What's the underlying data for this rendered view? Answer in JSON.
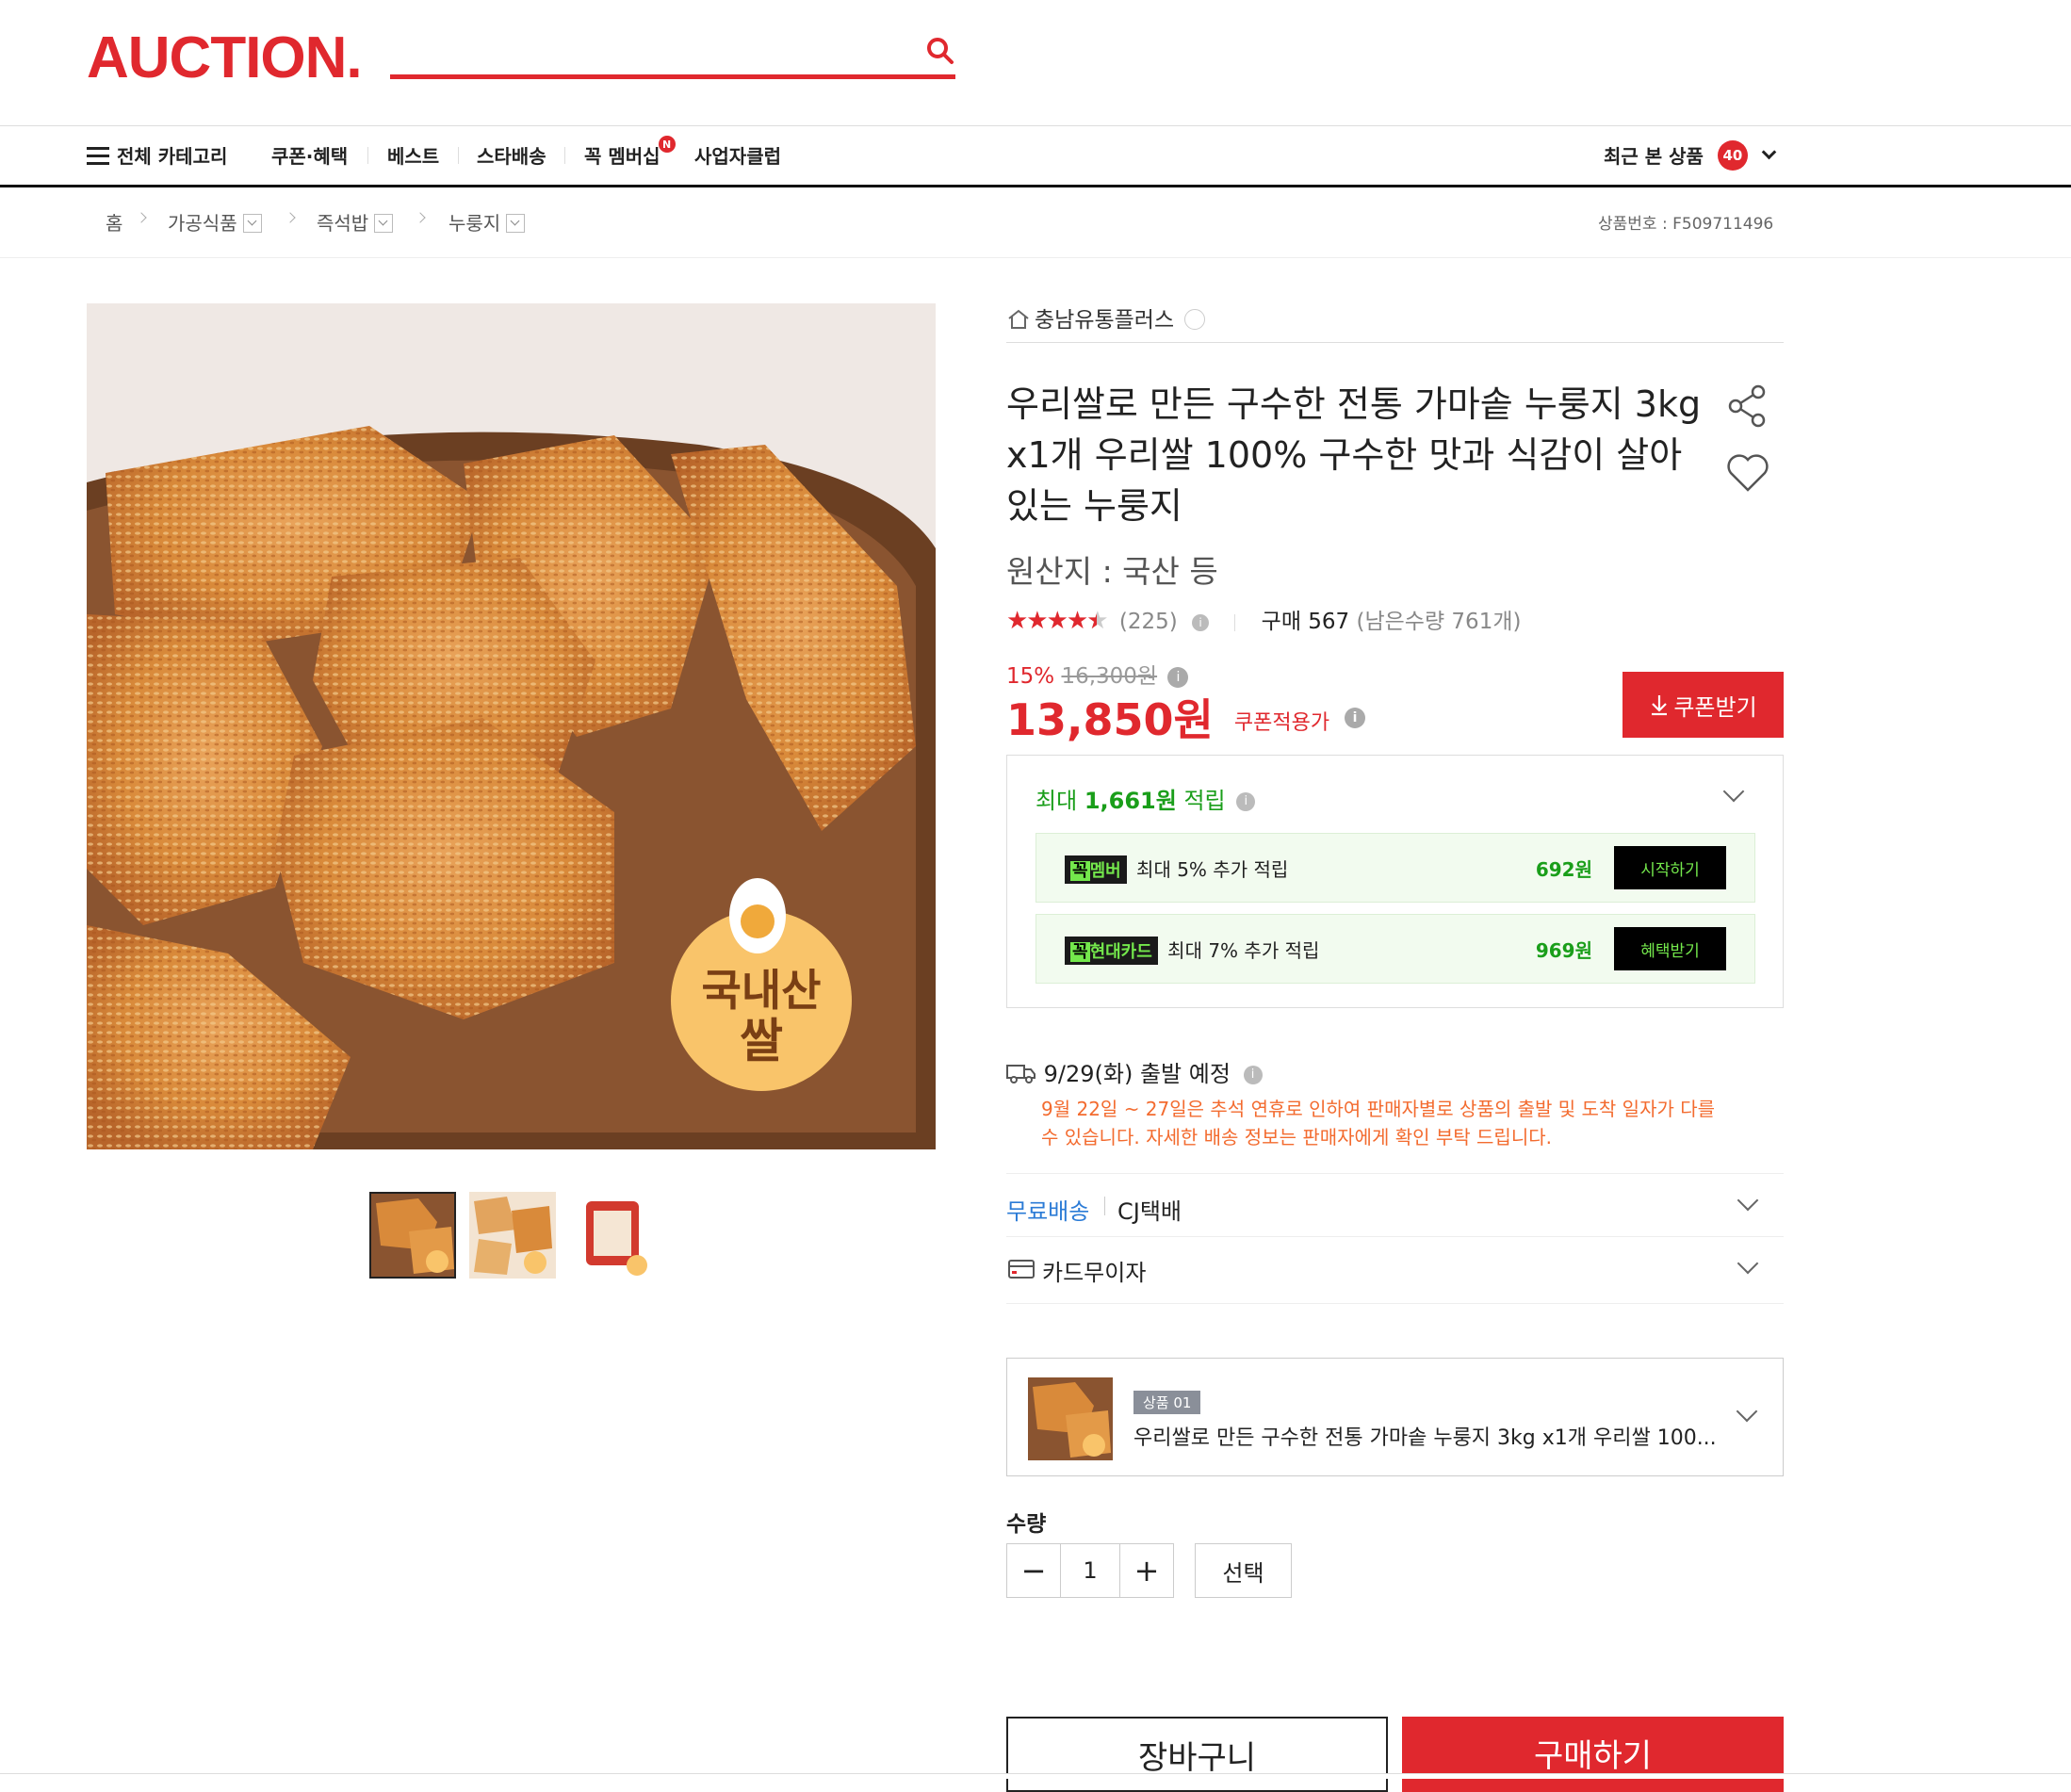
{
  "header": {
    "logo": "AUCTION.",
    "search_placeholder": ""
  },
  "gnb": {
    "all_category": "전체 카테고리",
    "items": [
      "쿠폰·혜택",
      "베스트",
      "스타배송",
      "꼭 멤버십",
      "사업자클럽"
    ],
    "new_badge": "N",
    "recent_label": "최근 본 상품",
    "recent_count": "40"
  },
  "breadcrumb": {
    "home": "홈",
    "items": [
      "가공식품",
      "즉석밥",
      "누룽지"
    ],
    "product_no": "상품번호 : F509711496"
  },
  "product": {
    "seller": "충남유통플러스",
    "title": "우리쌀로 만든 구수한 전통 가마솥 누룽지 3kg x1개 우리쌀 100% 구수한 맛과 식감이 살아있는 누룽지",
    "origin": "원산지 : 국산 등",
    "rating": 4.5,
    "review_count": "(225)",
    "purchase": "구매 567",
    "remaining": "(남은수량 761개)",
    "discount": "15%",
    "original_price": "16,300원",
    "price": "13,850원",
    "coupon_price_label": "쿠폰적용가",
    "coupon_button": "쿠폰받기",
    "image_badge": "국내산 쌀"
  },
  "reward": {
    "max_label": "최대",
    "max_amount": "1,661원",
    "max_suffix": "적립",
    "benefits": [
      {
        "badge_a": "꼭",
        "badge_b": "멤버",
        "text": "최대 5% 추가 적립",
        "amount": "692원",
        "button": "시작하기"
      },
      {
        "badge_a": "꼭",
        "badge_b": "현대카드",
        "text": "최대 7% 추가 적립",
        "amount": "969원",
        "button": "혜택받기"
      }
    ]
  },
  "shipping": {
    "date": "9/29(화) 출발 예정",
    "notice": "9월 22일 ~ 27일은 추석 연휴로 인하여 판매자별로 상품의 출발 및 도착 일자가 다를 수 있습니다. 자세한 배송 정보는 판매자에게 확인 부탁 드립니다.",
    "free": "무료배송",
    "carrier": "CJ택배",
    "card": "카드무이자"
  },
  "option": {
    "tag": "상품 01",
    "name": "우리쌀로 만든 구수한 전통 가마솥 누룽지 3kg x1개 우리쌀 100..."
  },
  "quantity": {
    "label": "수량",
    "value": "1",
    "minus": "−",
    "plus": "+",
    "select": "선택"
  },
  "actions": {
    "cart": "장바구니",
    "buy": "구매하기"
  },
  "colors": {
    "brand": "#e0282e",
    "reward": "#1a9e1a",
    "notice": "#f36b2f",
    "free_ship": "#2b7bd6"
  }
}
